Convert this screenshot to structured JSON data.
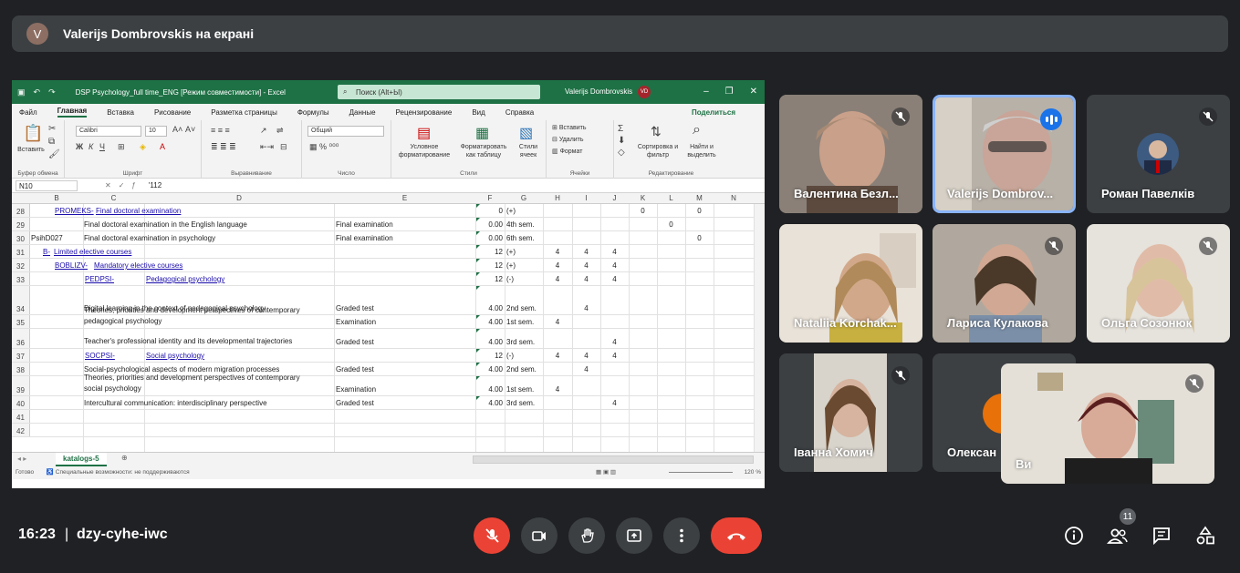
{
  "presenter": {
    "avatar_letter": "V",
    "text": "Valerijs Dombrovskis на екрані"
  },
  "excel": {
    "doc_title": "DSP Psychology_full time_ENG  [Режим совместимости]  -  Excel",
    "search": "Поиск (Alt+Ы)",
    "user": "Valerijs Dombrovskis",
    "user_initials": "VD",
    "menu": [
      "Файл",
      "Главная",
      "Вставка",
      "Рисование",
      "Разметка страницы",
      "Формулы",
      "Данные",
      "Рецензирование",
      "Вид",
      "Справка"
    ],
    "share": "Поделиться",
    "ribbon": {
      "paste": "Вставить",
      "clipboard": "Буфер обмена",
      "font_name": "Calibri",
      "font_size": "10",
      "font": "Шрифт",
      "align": "Выравнивание",
      "number_format": "Общий",
      "number": "Число",
      "cond_format": "Условное форматирование",
      "format_table": "Форматировать как таблицу",
      "cell_styles": "Стили ячеек",
      "styles": "Стили",
      "insert": "Вставить",
      "delete": "Удалить",
      "format": "Формат",
      "cells": "Ячейки",
      "sort": "Сортировка и фильтр",
      "find": "Найти и выделить",
      "editing": "Редактирование"
    },
    "name_box": "N10",
    "formula": "'112",
    "columns": [
      "B",
      "C",
      "D",
      "E",
      "F",
      "G",
      "H",
      "I",
      "J",
      "K",
      "L",
      "M",
      "N"
    ],
    "rows": [
      {
        "n": "28",
        "b": "",
        "code": "PROMEKS-",
        "name": "Final doctoral examination",
        "e": "",
        "f": "0",
        "g": "(+)",
        "h": "",
        "i": "",
        "j": "",
        "k": "0",
        "l": "",
        "m": "0"
      },
      {
        "n": "29",
        "b": "",
        "code": "",
        "name": "Final doctoral examination in the English language",
        "e": "Final examination",
        "f": "0.00",
        "g": "4th sem.",
        "h": "",
        "i": "",
        "j": "",
        "k": "",
        "l": "0",
        "m": ""
      },
      {
        "n": "30",
        "b": "PsihD027",
        "code": "",
        "name": "Final doctoral examination in psychology",
        "e": "Final examination",
        "f": "0.00",
        "g": "6th sem.",
        "h": "",
        "i": "",
        "j": "",
        "k": "",
        "l": "",
        "m": "0"
      },
      {
        "n": "31",
        "b": "",
        "code": "B-",
        "name": "Limited elective courses",
        "e": "",
        "f": "12",
        "g": "(+)",
        "h": "4",
        "i": "4",
        "j": "4",
        "k": "",
        "l": "",
        "m": ""
      },
      {
        "n": "32",
        "b": "",
        "code": "BOBLIZV-",
        "name": "Mandatory elective courses",
        "e": "",
        "f": "12",
        "g": "(+)",
        "h": "4",
        "i": "4",
        "j": "4",
        "k": "",
        "l": "",
        "m": ""
      },
      {
        "n": "33",
        "b": "",
        "code": "PEDPSI-",
        "name": "Pedagogical psychology",
        "e": "",
        "f": "12",
        "g": "(-)",
        "h": "4",
        "i": "4",
        "j": "4",
        "k": "",
        "l": "",
        "m": ""
      },
      {
        "n": "34",
        "b": "",
        "code": "",
        "name": "Digital learning in the context of pedagogical psychology",
        "e": "Graded test",
        "f": "4.00",
        "g": "2nd sem.",
        "h": "",
        "i": "4",
        "j": "",
        "k": "",
        "l": "",
        "m": ""
      },
      {
        "n": "35",
        "b": "",
        "code": "",
        "name": "Theories, priorities and development perspectives of contemporary pedagogical psychology",
        "e": "Examination",
        "f": "4.00",
        "g": "1st sem.",
        "h": "4",
        "i": "",
        "j": "",
        "k": "",
        "l": "",
        "m": ""
      },
      {
        "n": "36",
        "b": "",
        "code": "",
        "name": "Teacher's professional identity and its developmental trajectories",
        "e": "Graded test",
        "f": "4.00",
        "g": "3rd sem.",
        "h": "",
        "i": "",
        "j": "4",
        "k": "",
        "l": "",
        "m": ""
      },
      {
        "n": "37",
        "b": "",
        "code": "SOCPSI-",
        "name": "Social psychology",
        "e": "",
        "f": "12",
        "g": "(-)",
        "h": "4",
        "i": "4",
        "j": "4",
        "k": "",
        "l": "",
        "m": ""
      },
      {
        "n": "38",
        "b": "",
        "code": "",
        "name": "Social-psychological aspects of modern migration processes",
        "e": "Graded test",
        "f": "4.00",
        "g": "2nd sem.",
        "h": "",
        "i": "4",
        "j": "",
        "k": "",
        "l": "",
        "m": ""
      },
      {
        "n": "39",
        "b": "",
        "code": "",
        "name": "Theories, priorities and development perspectives of contemporary social psychology",
        "e": "Examination",
        "f": "4.00",
        "g": "1st sem.",
        "h": "4",
        "i": "",
        "j": "",
        "k": "",
        "l": "",
        "m": ""
      },
      {
        "n": "40",
        "b": "",
        "code": "",
        "name": "Intercultural communication: interdisciplinary perspective",
        "e": "Graded test",
        "f": "4.00",
        "g": "3rd sem.",
        "h": "",
        "i": "",
        "j": "4",
        "k": "",
        "l": "",
        "m": ""
      },
      {
        "n": "41",
        "b": "",
        "code": "",
        "name": "",
        "e": "",
        "f": "",
        "g": "",
        "h": "",
        "i": "",
        "j": "",
        "k": "",
        "l": "",
        "m": ""
      },
      {
        "n": "42",
        "b": "",
        "code": "",
        "name": "",
        "e": "",
        "f": "",
        "g": "",
        "h": "",
        "i": "",
        "j": "",
        "k": "",
        "l": "",
        "m": ""
      }
    ],
    "sheet_tab": "katalogs-5",
    "status_ready": "Готово",
    "status_access": "Специальные возможности: не поддерживаются",
    "zoom": "120 %"
  },
  "participants": [
    {
      "name": "Валентина Безл...",
      "muted": true,
      "speaking": false
    },
    {
      "name": "Valerijs Dombrov...",
      "muted": false,
      "speaking": true
    },
    {
      "name": "Роман Павелків",
      "muted": true,
      "speaking": false
    },
    {
      "name": "Nataliia Korchak...",
      "muted": false,
      "speaking": false
    },
    {
      "name": "Лариса Кулакова",
      "muted": true,
      "speaking": false
    },
    {
      "name": "Ольга Созонюк",
      "muted": true,
      "speaking": false
    },
    {
      "name": "Іванна Хомич",
      "muted": true,
      "speaking": false
    },
    {
      "name": "Олексан",
      "muted": false,
      "speaking": false
    },
    {
      "name": "Ви",
      "muted": true,
      "speaking": false
    }
  ],
  "meeting": {
    "time": "16:23",
    "separator": "|",
    "code": "dzy-cyhe-iwc",
    "people_count": "11"
  },
  "colors": {
    "bg": "#202124",
    "excel_green": "#1e7145",
    "end_call": "#ea4335",
    "mic_off": "#ea4335"
  }
}
